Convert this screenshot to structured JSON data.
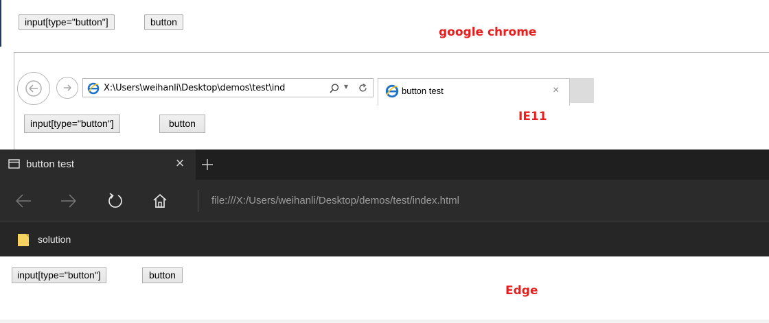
{
  "chrome": {
    "input_button_label": "input[type=\"button\"]",
    "button_label": "button",
    "caption": "google chrome"
  },
  "ie11": {
    "address_text": "X:\\Users\\weihanli\\Desktop\\demos\\test\\ind",
    "tab_title": "button test",
    "input_button_label": "input[type=\"button\"]",
    "button_label": "button",
    "caption": "IE11"
  },
  "edge": {
    "tab_title": "button test",
    "address_text": "file:///X:/Users/weihanli/Desktop/demos/test/index.html",
    "favorite_label": "solution",
    "input_button_label": "input[type=\"button\"]",
    "button_label": "button",
    "caption": "Edge",
    "colors": {
      "tabbar": "#1f1f1f",
      "toolbar": "#2b2b2b",
      "favorite_icon": "#f4d35e"
    }
  },
  "caption_color": "#e81e1e"
}
